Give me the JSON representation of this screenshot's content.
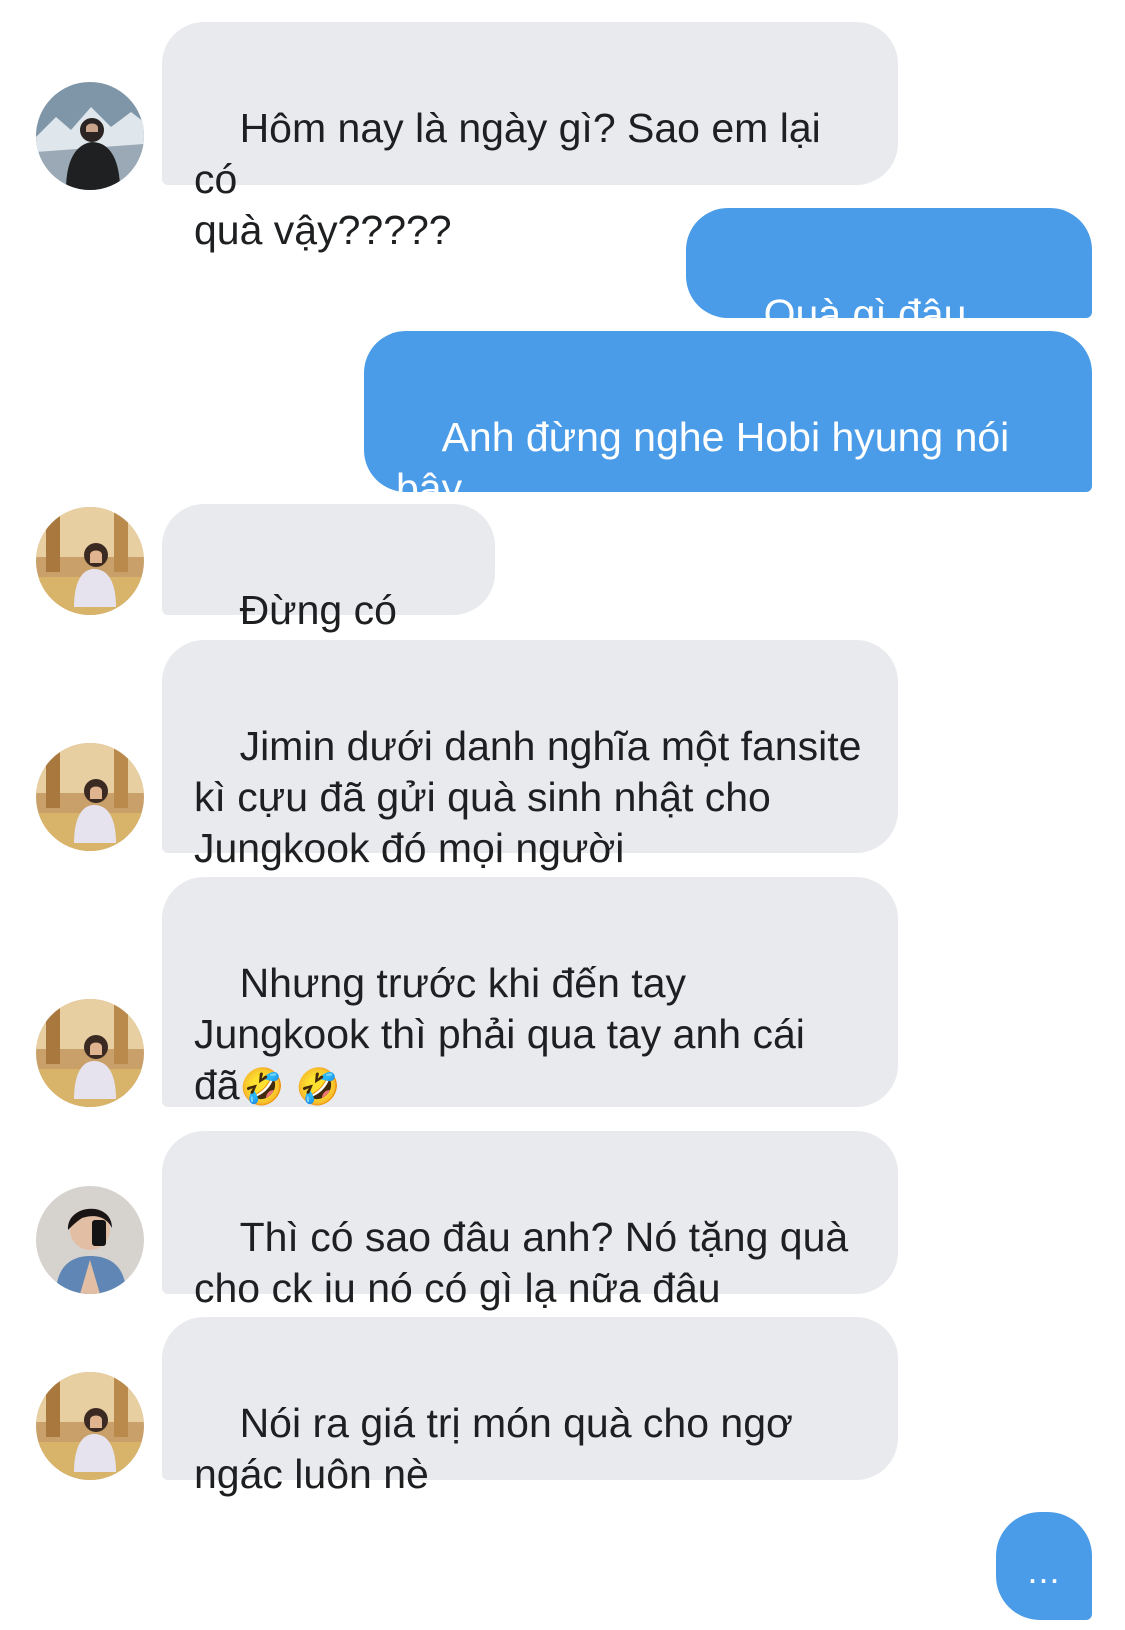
{
  "messages": [
    {
      "sender": "hyung-mountain",
      "text": "Hôm nay là ngày gì? Sao em lại có\nquà vậy?????"
    },
    {
      "sender": "me",
      "text": "Quà gì đâu hyung"
    },
    {
      "sender": "me",
      "text": "Anh đừng nghe Hobi hyung nói\nbậy"
    },
    {
      "sender": "hyung-warm",
      "text": "Đừng có chối"
    },
    {
      "sender": "hyung-warm",
      "text": "Jimin dưới danh nghĩa một fansite\nkì cựu đã gửi quà sinh nhật cho\nJungkook đó mọi người"
    },
    {
      "sender": "hyung-warm",
      "text": "Nhưng trước khi đến tay\nJungkook thì phải qua tay anh cái\nđã",
      "emoji": "🤣 🤣"
    },
    {
      "sender": "hyung-selfie",
      "text": "Thì có sao đâu anh? Nó tặng quà\ncho ck iu nó có gì lạ nữa đâu"
    },
    {
      "sender": "hyung-warm",
      "text": "Nói ra giá trị món quà cho ngơ\nngác luôn nè"
    }
  ],
  "typing_indicator": "...",
  "colors": {
    "incoming_bubble": "#e9eaee",
    "outgoing_bubble": "#4b9ce8",
    "incoming_text": "#1d1f21",
    "outgoing_text": "#ffffff"
  },
  "avatars": {
    "hyung-mountain": "person-on-snowy-mountain-avatar",
    "hyung-warm": "person-seated-warm-light-avatar",
    "hyung-selfie": "mirror-selfie-avatar"
  }
}
